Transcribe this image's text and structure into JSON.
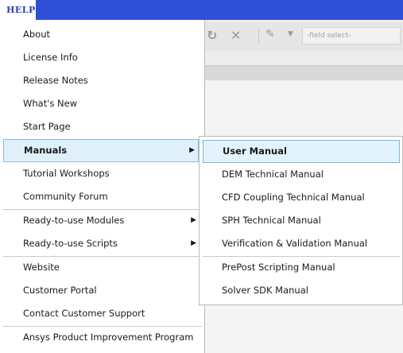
{
  "menubar": {
    "title": "HELP"
  },
  "toolbar": {
    "field_select_placeholder": "-field select-"
  },
  "menu": {
    "items": [
      {
        "label": "About"
      },
      {
        "label": "License Info"
      },
      {
        "label": "Release Notes"
      },
      {
        "label": "What's New"
      },
      {
        "label": "Start Page"
      },
      {
        "label": "Manuals",
        "has_submenu": true,
        "highlighted": true
      },
      {
        "label": "Tutorial Workshops"
      },
      {
        "label": "Community Forum"
      },
      {
        "label": "Ready-to-use Modules",
        "has_submenu": true
      },
      {
        "label": "Ready-to-use Scripts",
        "has_submenu": true
      },
      {
        "label": "Website"
      },
      {
        "label": "Customer Portal"
      },
      {
        "label": "Contact Customer Support"
      },
      {
        "label": "Ansys Product Improvement Program"
      }
    ]
  },
  "submenu": {
    "items": [
      {
        "label": "User Manual",
        "highlighted": true
      },
      {
        "label": "DEM Technical Manual"
      },
      {
        "label": "CFD Coupling Technical Manual"
      },
      {
        "label": "SPH Technical Manual"
      },
      {
        "label": "Verification & Validation Manual"
      },
      {
        "label": "PrePost Scripting Manual"
      },
      {
        "label": "Solver SDK Manual"
      }
    ]
  },
  "icons": {
    "submenu_arrow": "triangle-right-icon"
  },
  "colors": {
    "menubar_bg": "#2f4fd8",
    "highlight_bg": "#dff0fb",
    "highlight_border": "#8fb8e0"
  }
}
